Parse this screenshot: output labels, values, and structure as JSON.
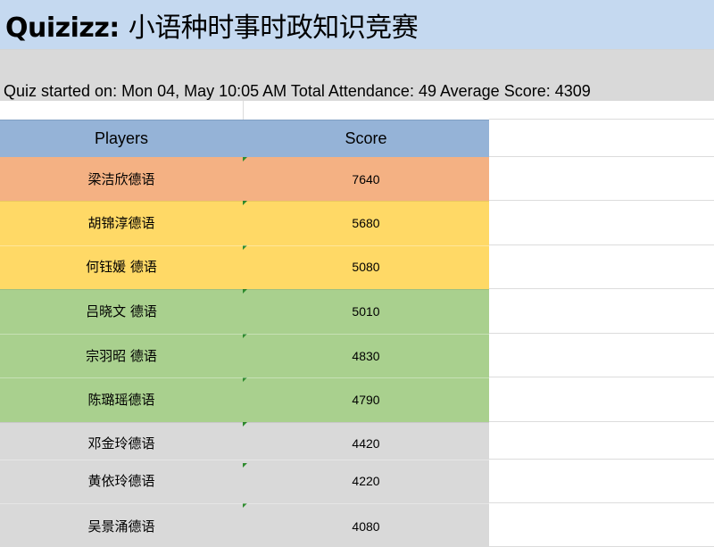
{
  "title": {
    "brand": "Quizizz:",
    "text": "小语种时事时政知识竞赛"
  },
  "meta": "Quiz started on: Mon 04, May 10:05 AM Total Attendance: 49 Average Score: 4309",
  "table": {
    "headers": {
      "players": "Players",
      "score": "Score"
    },
    "rows": [
      {
        "player": "梁洁欣德语",
        "score": "7640",
        "tier": "top"
      },
      {
        "player": "胡锦淳德语",
        "score": "5680",
        "tier": "high"
      },
      {
        "player": "何钰媛 德语",
        "score": "5080",
        "tier": "high"
      },
      {
        "player": "吕晓文 德语",
        "score": "5010",
        "tier": "mid"
      },
      {
        "player": "宗羽昭 德语",
        "score": "4830",
        "tier": "mid"
      },
      {
        "player": "陈璐瑶德语",
        "score": "4790",
        "tier": "mid"
      },
      {
        "player": "邓金玲德语",
        "score": "4420",
        "tier": "low"
      },
      {
        "player": "黄依玲德语",
        "score": "4220",
        "tier": "low"
      },
      {
        "player": "吴景涌德语",
        "score": "4080",
        "tier": "low"
      }
    ]
  },
  "colors": {
    "title_band": "#c5d9f0",
    "meta_band": "#d9d9d9",
    "header": "#95b3d7",
    "top": "#f4b183",
    "high": "#ffd966",
    "mid": "#a9d08e",
    "low": "#d9d9d9",
    "marker": "#2e8b2e"
  }
}
